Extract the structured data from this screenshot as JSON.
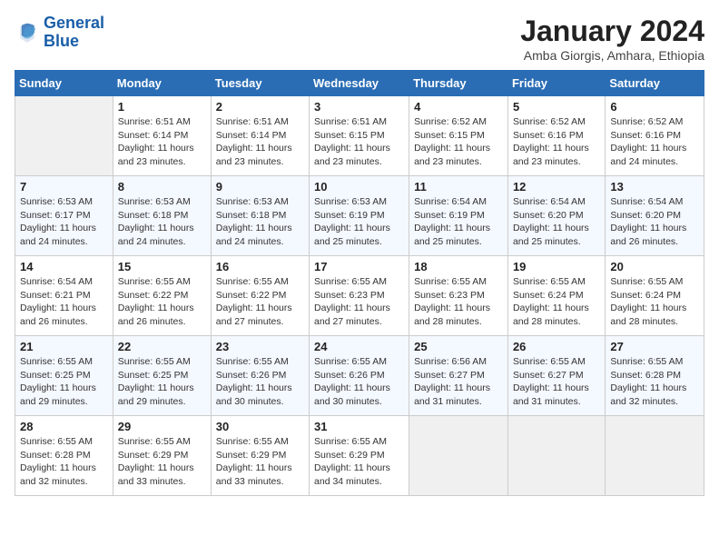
{
  "header": {
    "logo_line1": "General",
    "logo_line2": "Blue",
    "month_year": "January 2024",
    "location": "Amba Giorgis, Amhara, Ethiopia"
  },
  "days_of_week": [
    "Sunday",
    "Monday",
    "Tuesday",
    "Wednesday",
    "Thursday",
    "Friday",
    "Saturday"
  ],
  "weeks": [
    [
      {
        "day": "",
        "info": ""
      },
      {
        "day": "1",
        "info": "Sunrise: 6:51 AM\nSunset: 6:14 PM\nDaylight: 11 hours\nand 23 minutes."
      },
      {
        "day": "2",
        "info": "Sunrise: 6:51 AM\nSunset: 6:14 PM\nDaylight: 11 hours\nand 23 minutes."
      },
      {
        "day": "3",
        "info": "Sunrise: 6:51 AM\nSunset: 6:15 PM\nDaylight: 11 hours\nand 23 minutes."
      },
      {
        "day": "4",
        "info": "Sunrise: 6:52 AM\nSunset: 6:15 PM\nDaylight: 11 hours\nand 23 minutes."
      },
      {
        "day": "5",
        "info": "Sunrise: 6:52 AM\nSunset: 6:16 PM\nDaylight: 11 hours\nand 23 minutes."
      },
      {
        "day": "6",
        "info": "Sunrise: 6:52 AM\nSunset: 6:16 PM\nDaylight: 11 hours\nand 24 minutes."
      }
    ],
    [
      {
        "day": "7",
        "info": "Sunrise: 6:53 AM\nSunset: 6:17 PM\nDaylight: 11 hours\nand 24 minutes."
      },
      {
        "day": "8",
        "info": "Sunrise: 6:53 AM\nSunset: 6:18 PM\nDaylight: 11 hours\nand 24 minutes."
      },
      {
        "day": "9",
        "info": "Sunrise: 6:53 AM\nSunset: 6:18 PM\nDaylight: 11 hours\nand 24 minutes."
      },
      {
        "day": "10",
        "info": "Sunrise: 6:53 AM\nSunset: 6:19 PM\nDaylight: 11 hours\nand 25 minutes."
      },
      {
        "day": "11",
        "info": "Sunrise: 6:54 AM\nSunset: 6:19 PM\nDaylight: 11 hours\nand 25 minutes."
      },
      {
        "day": "12",
        "info": "Sunrise: 6:54 AM\nSunset: 6:20 PM\nDaylight: 11 hours\nand 25 minutes."
      },
      {
        "day": "13",
        "info": "Sunrise: 6:54 AM\nSunset: 6:20 PM\nDaylight: 11 hours\nand 26 minutes."
      }
    ],
    [
      {
        "day": "14",
        "info": "Sunrise: 6:54 AM\nSunset: 6:21 PM\nDaylight: 11 hours\nand 26 minutes."
      },
      {
        "day": "15",
        "info": "Sunrise: 6:55 AM\nSunset: 6:22 PM\nDaylight: 11 hours\nand 26 minutes."
      },
      {
        "day": "16",
        "info": "Sunrise: 6:55 AM\nSunset: 6:22 PM\nDaylight: 11 hours\nand 27 minutes."
      },
      {
        "day": "17",
        "info": "Sunrise: 6:55 AM\nSunset: 6:23 PM\nDaylight: 11 hours\nand 27 minutes."
      },
      {
        "day": "18",
        "info": "Sunrise: 6:55 AM\nSunset: 6:23 PM\nDaylight: 11 hours\nand 28 minutes."
      },
      {
        "day": "19",
        "info": "Sunrise: 6:55 AM\nSunset: 6:24 PM\nDaylight: 11 hours\nand 28 minutes."
      },
      {
        "day": "20",
        "info": "Sunrise: 6:55 AM\nSunset: 6:24 PM\nDaylight: 11 hours\nand 28 minutes."
      }
    ],
    [
      {
        "day": "21",
        "info": "Sunrise: 6:55 AM\nSunset: 6:25 PM\nDaylight: 11 hours\nand 29 minutes."
      },
      {
        "day": "22",
        "info": "Sunrise: 6:55 AM\nSunset: 6:25 PM\nDaylight: 11 hours\nand 29 minutes."
      },
      {
        "day": "23",
        "info": "Sunrise: 6:55 AM\nSunset: 6:26 PM\nDaylight: 11 hours\nand 30 minutes."
      },
      {
        "day": "24",
        "info": "Sunrise: 6:55 AM\nSunset: 6:26 PM\nDaylight: 11 hours\nand 30 minutes."
      },
      {
        "day": "25",
        "info": "Sunrise: 6:56 AM\nSunset: 6:27 PM\nDaylight: 11 hours\nand 31 minutes."
      },
      {
        "day": "26",
        "info": "Sunrise: 6:55 AM\nSunset: 6:27 PM\nDaylight: 11 hours\nand 31 minutes."
      },
      {
        "day": "27",
        "info": "Sunrise: 6:55 AM\nSunset: 6:28 PM\nDaylight: 11 hours\nand 32 minutes."
      }
    ],
    [
      {
        "day": "28",
        "info": "Sunrise: 6:55 AM\nSunset: 6:28 PM\nDaylight: 11 hours\nand 32 minutes."
      },
      {
        "day": "29",
        "info": "Sunrise: 6:55 AM\nSunset: 6:29 PM\nDaylight: 11 hours\nand 33 minutes."
      },
      {
        "day": "30",
        "info": "Sunrise: 6:55 AM\nSunset: 6:29 PM\nDaylight: 11 hours\nand 33 minutes."
      },
      {
        "day": "31",
        "info": "Sunrise: 6:55 AM\nSunset: 6:29 PM\nDaylight: 11 hours\nand 34 minutes."
      },
      {
        "day": "",
        "info": ""
      },
      {
        "day": "",
        "info": ""
      },
      {
        "day": "",
        "info": ""
      }
    ]
  ]
}
